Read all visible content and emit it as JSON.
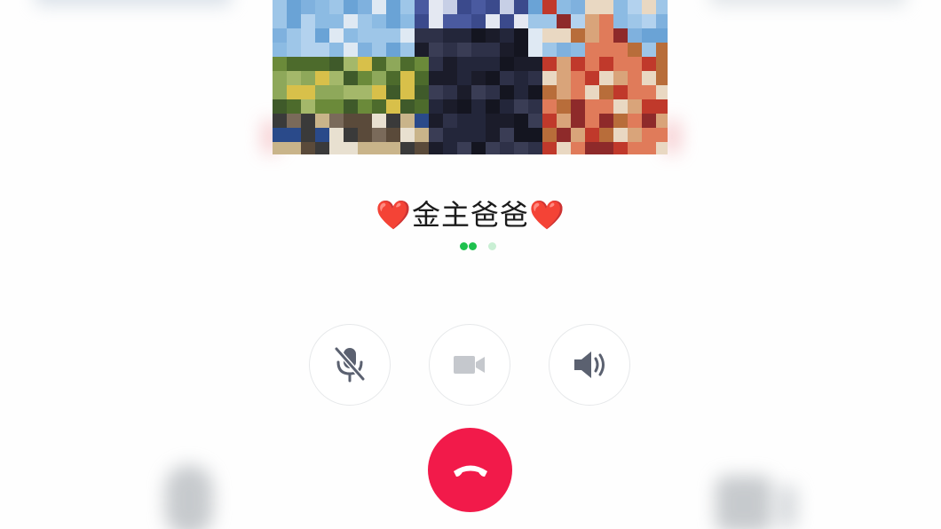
{
  "call": {
    "contact_name": "❤️金主爸爸❤️",
    "status": "connecting"
  },
  "controls": [
    {
      "id": "mute",
      "icon": "microphone-muted-icon",
      "state": "muted"
    },
    {
      "id": "video",
      "icon": "video-camera-icon",
      "state": "disabled"
    },
    {
      "id": "speaker",
      "icon": "speaker-icon",
      "state": "enabled"
    }
  ],
  "hangup": {
    "icon": "hang-up-phone-icon"
  },
  "colors": {
    "accent_green": "#1ec14e",
    "hangup_red": "#f21a4a",
    "icon_gray": "#5b6170",
    "icon_disabled": "#c5c8cd"
  }
}
